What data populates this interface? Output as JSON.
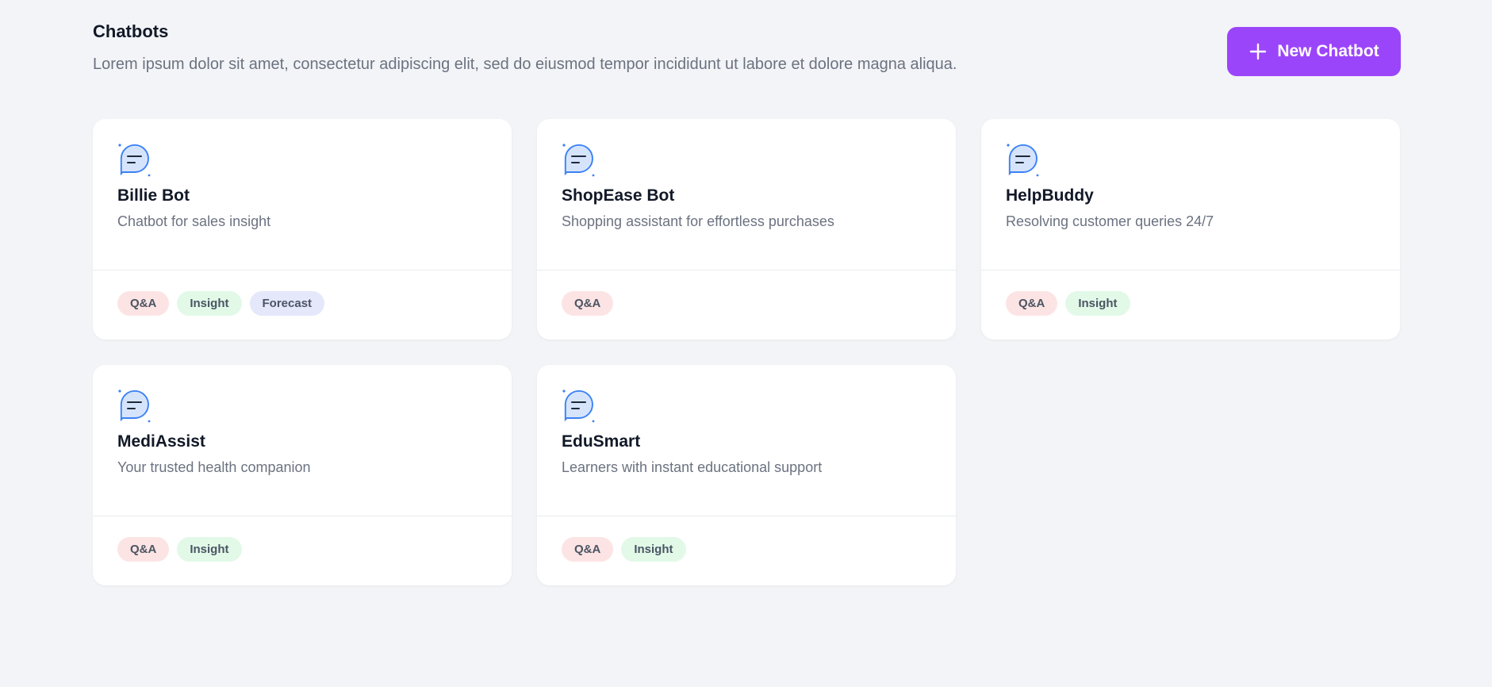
{
  "header": {
    "title": "Chatbots",
    "subtitle": "Lorem ipsum dolor sit amet, consectetur adipiscing elit, sed do eiusmod tempor incididunt ut labore et dolore magna aliqua.",
    "new_button_label": "New Chatbot",
    "new_button_icon": "plus-icon",
    "accent_color": "#9b45fb"
  },
  "cards": [
    {
      "icon": "chat-bubble-icon",
      "name": "Billie Bot",
      "description": "Chatbot for sales insight",
      "tags": [
        "Q&A",
        "Insight",
        "Forecast"
      ]
    },
    {
      "icon": "chat-bubble-icon",
      "name": "ShopEase Bot",
      "description": "Shopping assistant for effortless purchases",
      "tags": [
        "Q&A"
      ]
    },
    {
      "icon": "chat-bubble-icon",
      "name": "HelpBuddy",
      "description": "Resolving customer queries 24/7",
      "tags": [
        "Q&A",
        "Insight"
      ]
    },
    {
      "icon": "chat-bubble-icon",
      "name": "MediAssist",
      "description": "Your trusted health companion",
      "tags": [
        "Q&A",
        "Insight"
      ]
    },
    {
      "icon": "chat-bubble-icon",
      "name": "EduSmart",
      "description": "Learners with instant educational support",
      "tags": [
        "Q&A",
        "Insight"
      ]
    }
  ],
  "tag_colors": {
    "Q&A": "#fde4e4",
    "Insight": "#e2f9e8",
    "Forecast": "#e5e7fb"
  }
}
